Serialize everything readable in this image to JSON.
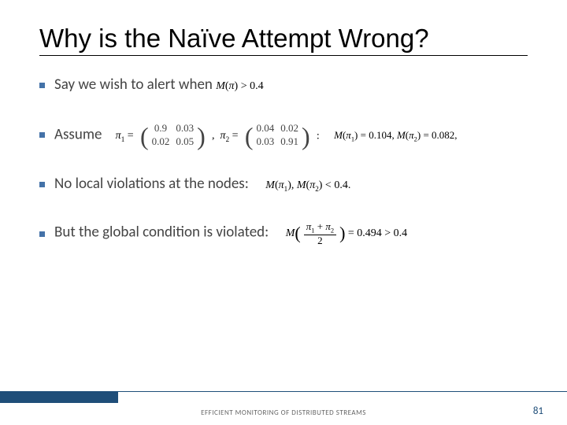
{
  "title": "Why is the Naïve Attempt Wrong?",
  "bullets": {
    "b1_pre": "Say we wish to alert when ",
    "b1_expr": "M(π) > 0.4",
    "b2_pre": "Assume",
    "b2_m1": {
      "r1": [
        "0.9",
        "0.03"
      ],
      "r2": [
        "0.02",
        "0.05"
      ]
    },
    "b2_m2": {
      "r1": [
        "0.04",
        "0.02"
      ],
      "r2": [
        "0.03",
        "0.91"
      ]
    },
    "b2_post": "M(π₁) = 0.104, M(π₂) = 0.082,",
    "b3": "No local violations at the nodes:",
    "b3_expr": "M(π₁), M(π₂) < 0.4.",
    "b4": "But the global condition is violated:",
    "b4_frac_num": "π₁ + π₂",
    "b4_frac_den": "2",
    "b4_post": " = 0.494 > 0.4"
  },
  "footer": "EFFICIENT MONITORING OF DISTRIBUTED STREAMS",
  "page": "81"
}
